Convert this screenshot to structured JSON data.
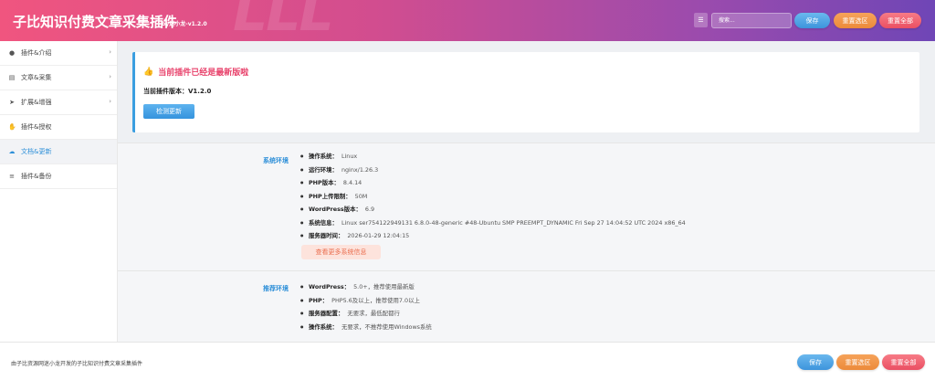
{
  "header": {
    "title": "子比知识付费文章采集插件",
    "version_tag": "by迷小龙-v1.2.0",
    "search_placeholder": "搜索...",
    "save_label": "保存",
    "reset_selection_label": "重置选区",
    "reset_all_label": "重置全部"
  },
  "sidebar": {
    "items": [
      {
        "label": "插件&介绍",
        "icon": "info-icon"
      },
      {
        "label": "文章&采集",
        "icon": "file-icon"
      },
      {
        "label": "扩展&增强",
        "icon": "rocket-icon"
      },
      {
        "label": "插件&授权",
        "icon": "handshake-icon"
      },
      {
        "label": "文档&更新",
        "icon": "cloud-icon"
      },
      {
        "label": "插件&备份",
        "icon": "database-icon"
      }
    ],
    "active_index": 4
  },
  "notice": {
    "heading": "当前插件已经是最新版啦",
    "current_version_label": "当前插件版本：",
    "current_version_value": "V1.2.0",
    "check_update_label": "检测更新"
  },
  "system_env": {
    "label": "系统环境",
    "items": [
      {
        "key": "操作系统：",
        "value": "Linux"
      },
      {
        "key": "运行环境：",
        "value": "nginx/1.26.3"
      },
      {
        "key": "PHP版本：",
        "value": "8.4.14"
      },
      {
        "key": "PHP上传限制：",
        "value": "50M"
      },
      {
        "key": "WordPress版本：",
        "value": "6.9"
      },
      {
        "key": "系统信息：",
        "value": "Linux ser754122949131 6.8.0-48-generic #48-Ubuntu SMP PREEMPT_DYNAMIC Fri Sep 27 14:04:52 UTC 2024 x86_64"
      },
      {
        "key": "服务器时间：",
        "value": "2026-01-29 12:04:15"
      }
    ],
    "more_label": "查看更多系统信息"
  },
  "recommend_env": {
    "label": "推荐环境",
    "items": [
      {
        "key": "WordPress：",
        "value": "5.0+，推荐使用最新版"
      },
      {
        "key": "PHP：",
        "value": "PHP5.6及以上，推荐使用7.0以上"
      },
      {
        "key": "服务器配置：",
        "value": "无要求，最低配都行"
      },
      {
        "key": "操作系统：",
        "value": "无要求，不推荐使用Windows系统"
      }
    ]
  },
  "footer": {
    "text": "由子比资源网迷小龙开发的子比知识付费文章采集插件",
    "save_label": "保存",
    "reset_selection_label": "重置选区",
    "reset_all_label": "重置全部"
  },
  "colors": {
    "accent_blue": "#2d8fd8",
    "heading_red": "#e8436c",
    "header_gradient_start": "#f0557f",
    "header_gradient_end": "#6f46b6"
  }
}
